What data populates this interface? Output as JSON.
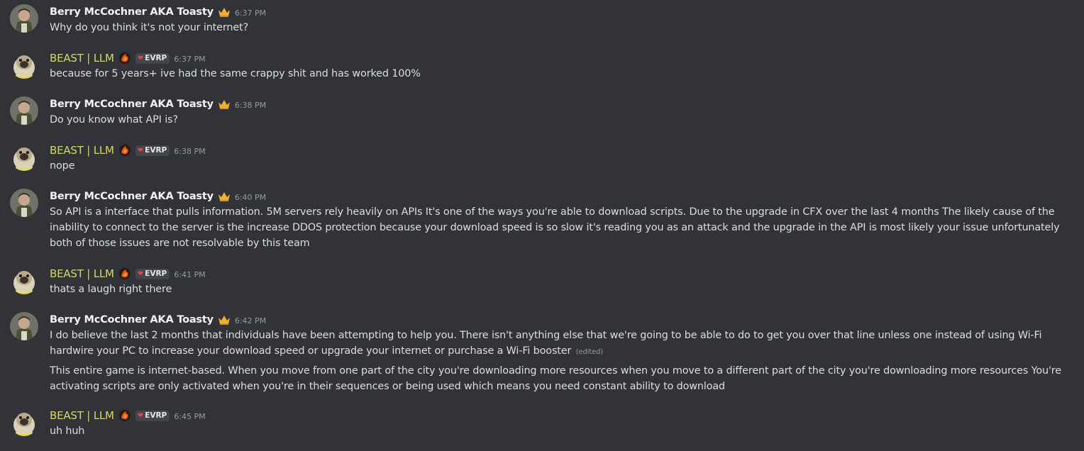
{
  "users": {
    "berry": {
      "name": "Berry McCochner AKA Toasty",
      "badge_icon": "crown-icon"
    },
    "beast": {
      "name": "BEAST | LLM",
      "badge_icon": "flame-badge-icon",
      "tag": "EVRP",
      "tag_icon": "heart-icon"
    }
  },
  "messages": [
    {
      "author": "Berry McCochner AKA Toasty",
      "time": "6:37 PM",
      "lines": [
        "Why do you think it's not your internet?"
      ]
    },
    {
      "author": "BEAST | LLM",
      "tag": "EVRP",
      "time": "6:37 PM",
      "lines": [
        "because for 5 years+ ive had the same crappy shit and has worked 100%"
      ]
    },
    {
      "author": "Berry McCochner AKA Toasty",
      "time": "6:38 PM",
      "lines": [
        "Do you know what API is?"
      ]
    },
    {
      "author": "BEAST | LLM",
      "tag": "EVRP",
      "time": "6:38 PM",
      "lines": [
        "nope"
      ]
    },
    {
      "author": "Berry McCochner AKA Toasty",
      "time": "6:40 PM",
      "lines": [
        "So API is a interface that pulls information. 5M servers rely heavily on APIs It's one of the ways you're able to download scripts. Due to the upgrade in CFX over the last 4 months The likely cause of the inability to connect to the server is the increase DDOS protection because your download speed is so slow it's reading you as an attack and the upgrade in the API is most likely your issue unfortunately both of those issues are not resolvable by this team"
      ]
    },
    {
      "author": "BEAST | LLM",
      "tag": "EVRP",
      "time": "6:41 PM",
      "lines": [
        "thats a laugh right there"
      ]
    },
    {
      "author": "Berry McCochner AKA Toasty",
      "time": "6:42 PM",
      "lines": [
        "I do believe the last 2 months that individuals have been attempting to help you. There isn't anything else that we're going to be able to do to get you over that line unless one instead of using Wi-Fi hardwire your PC to increase your download speed or upgrade your internet or purchase a Wi-Fi booster",
        "This entire game is internet-based. When you move from one part of the city you're downloading more resources when you move to a different part of the city you're downloading more resources You're activating scripts are only activated when you're in their sequences or being used which means you need constant ability to download"
      ],
      "edited_label": "(edited)"
    },
    {
      "author": "BEAST | LLM",
      "tag": "EVRP",
      "time": "6:45 PM",
      "lines": [
        "uh huh"
      ]
    }
  ]
}
